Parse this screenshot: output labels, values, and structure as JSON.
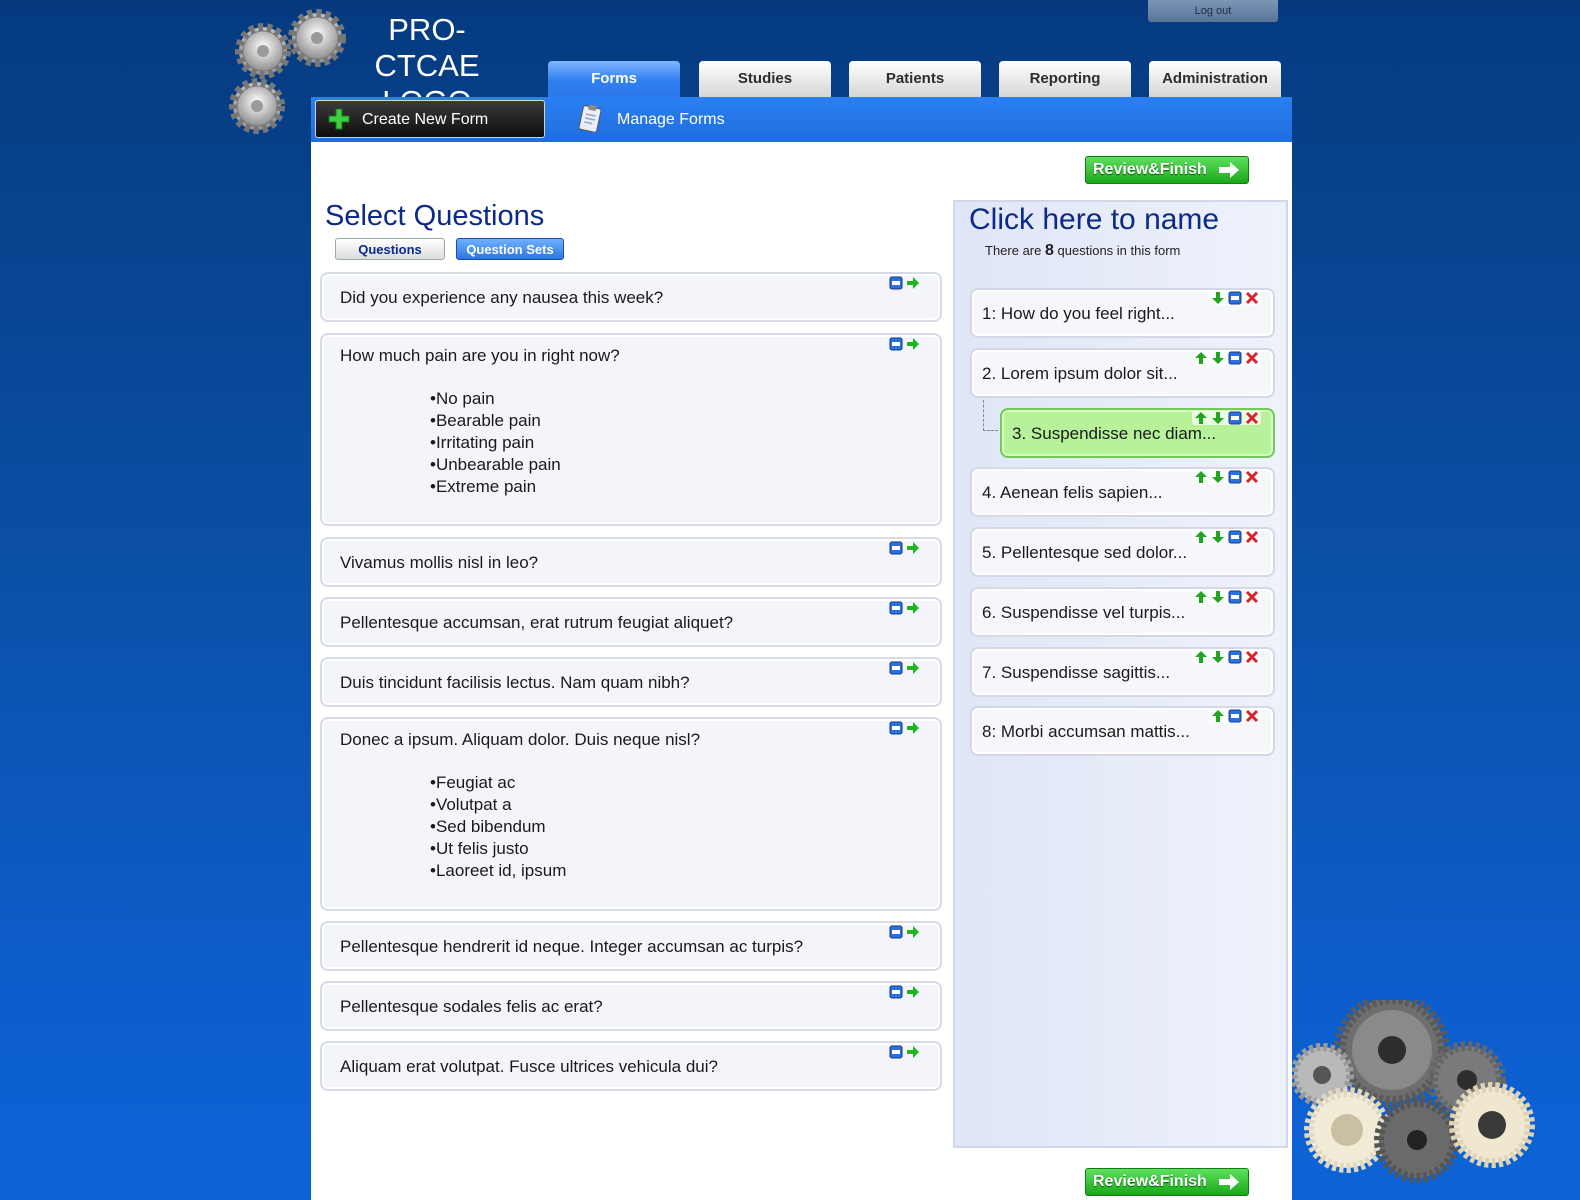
{
  "header": {
    "logo_text": "PRO-CTCAE LOGO",
    "logout_label": "Log out",
    "tabs": [
      {
        "label": "Forms",
        "active": true
      },
      {
        "label": "Studies",
        "active": false
      },
      {
        "label": "Patients",
        "active": false
      },
      {
        "label": "Reporting",
        "active": false
      },
      {
        "label": "Administration",
        "active": false
      }
    ]
  },
  "subnav": {
    "create_label": "Create New Form",
    "manage_label": "Manage Forms"
  },
  "review_label": "Review&Finish",
  "select": {
    "title": "Select Questions",
    "tab_questions": "Questions",
    "tab_sets": "Question Sets",
    "questions": [
      {
        "text": "Did you experience any nausea this week?",
        "options": []
      },
      {
        "text": "How much pain are you in right now?",
        "options": [
          "No pain",
          "Bearable pain",
          "Irritating pain",
          "Unbearable pain",
          "Extreme pain"
        ]
      },
      {
        "text": "Vivamus mollis nisl in leo?",
        "options": []
      },
      {
        "text": "Pellentesque accumsan, erat rutrum feugiat aliquet?",
        "options": []
      },
      {
        "text": "Duis tincidunt facilisis lectus. Nam quam nibh?",
        "options": []
      },
      {
        "text": "Donec a ipsum. Aliquam dolor. Duis neque nisl?",
        "options": [
          "Feugiat ac",
          "Volutpat a",
          "Sed bibendum",
          "Ut felis justo",
          "Laoreet id, ipsum"
        ]
      },
      {
        "text": "Pellentesque hendrerit id neque. Integer accumsan ac turpis?",
        "options": []
      },
      {
        "text": "Pellentesque sodales felis ac erat?",
        "options": []
      },
      {
        "text": "Aliquam erat volutpat. Fusce ultrices vehicula dui?",
        "options": []
      }
    ]
  },
  "form": {
    "title": "Click here to name",
    "count_prefix": "There are",
    "count": "8",
    "count_suffix": "questions in this form",
    "items": [
      {
        "label": "1: How do you feel right...",
        "up": false,
        "down": true,
        "nested": false
      },
      {
        "label": "2. Lorem ipsum dolor sit...",
        "up": true,
        "down": true,
        "nested": false
      },
      {
        "label": "3. Suspendisse nec diam...",
        "up": true,
        "down": true,
        "nested": true
      },
      {
        "label": "4. Aenean felis sapien...",
        "up": true,
        "down": true,
        "nested": false
      },
      {
        "label": "5. Pellentesque sed dolor...",
        "up": true,
        "down": true,
        "nested": false
      },
      {
        "label": "6. Suspendisse vel turpis...",
        "up": true,
        "down": true,
        "nested": false
      },
      {
        "label": "7. Suspendisse sagittis...",
        "up": true,
        "down": true,
        "nested": false
      },
      {
        "label": "8: Morbi accumsan mattis...",
        "up": true,
        "down": false,
        "nested": false
      }
    ]
  },
  "icons": {
    "gear": "gear-icon",
    "plus": "plus-icon",
    "clipboard": "clipboard-icon",
    "arrow_right": "arrow-right-icon",
    "edit": "edit-icon",
    "add": "add-to-form-icon",
    "up": "move-up-icon",
    "down": "move-down-icon",
    "remove": "remove-icon"
  },
  "colors": {
    "accent_blue": "#2b7ff0",
    "title_navy": "#0b2a8a",
    "review_green": "#19a819",
    "selected_item": "#b7f29a"
  }
}
